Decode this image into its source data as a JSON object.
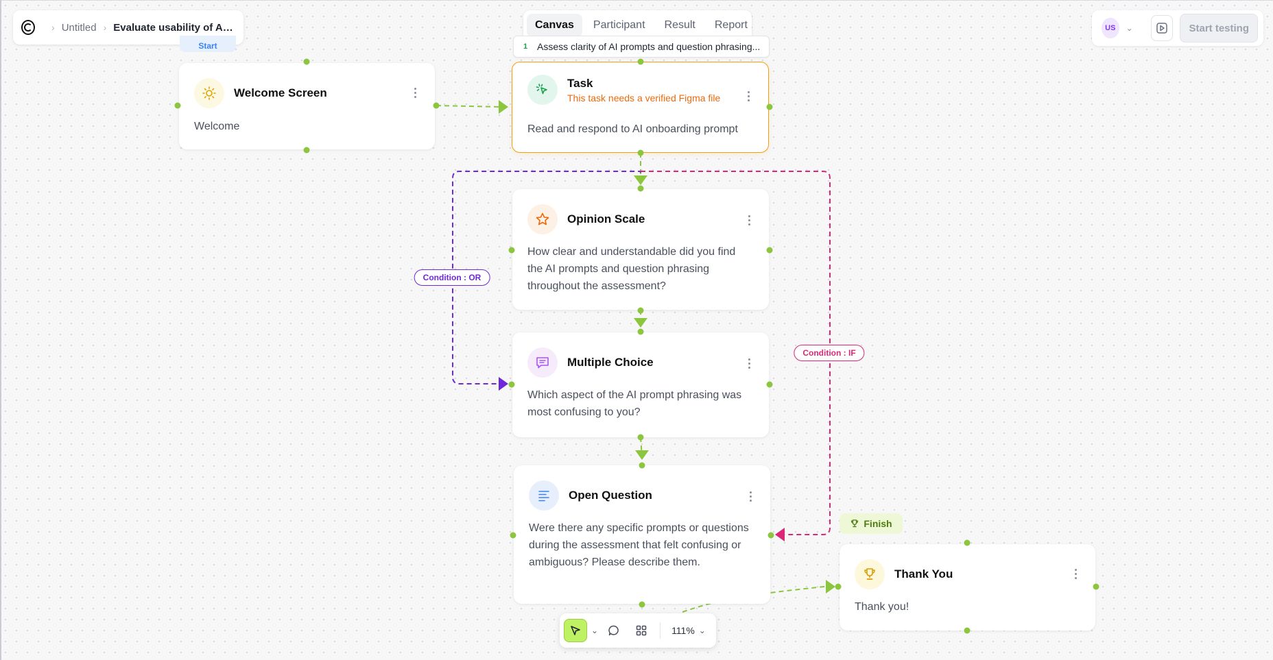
{
  "breadcrumb": {
    "root": "Untitled",
    "current": "Evaluate usability of AI-gu..."
  },
  "tabs": [
    "Canvas",
    "Participant",
    "Result",
    "Report"
  ],
  "active_tab": "Canvas",
  "user": {
    "initials": "US"
  },
  "header": {
    "start_testing": "Start testing"
  },
  "goal": {
    "number": "1",
    "text": "Assess clarity of AI prompts and question phrasing..."
  },
  "start_tag": "Start",
  "nodes": {
    "welcome": {
      "title": "Welcome Screen",
      "body": "Welcome"
    },
    "task": {
      "title": "Task",
      "warning": "This task needs a verified Figma file",
      "body": "Read and respond to AI onboarding prompt"
    },
    "opinion": {
      "title": "Opinion Scale",
      "body": "How clear and understandable did you find the AI prompts and question phrasing throughout the assessment?"
    },
    "multiple": {
      "title": "Multiple Choice",
      "body": "Which aspect of the AI prompt phrasing was most confusing to you?"
    },
    "open": {
      "title": "Open Question",
      "body": "Were there any specific prompts or questions during the assessment that felt confusing or ambiguous? Please describe them."
    },
    "thankyou": {
      "title": "Thank You",
      "body": "Thank you!"
    }
  },
  "conditions": {
    "or": "Condition : OR",
    "if": "Condition : IF"
  },
  "finish_tag": "Finish",
  "toolbar": {
    "zoom": "111%"
  },
  "colors": {
    "edge_default": "#8cc63f",
    "edge_or": "#6d28d9",
    "edge_if": "#db2777",
    "task_border": "#f59e0b",
    "warning": "#ea6a0c"
  },
  "icons": [
    "sun-icon",
    "cursor-click-icon",
    "star-icon",
    "chat-list-icon",
    "text-align-icon",
    "trophy-icon",
    "pointer-icon",
    "comment-icon",
    "grid-icon",
    "play-icon"
  ]
}
